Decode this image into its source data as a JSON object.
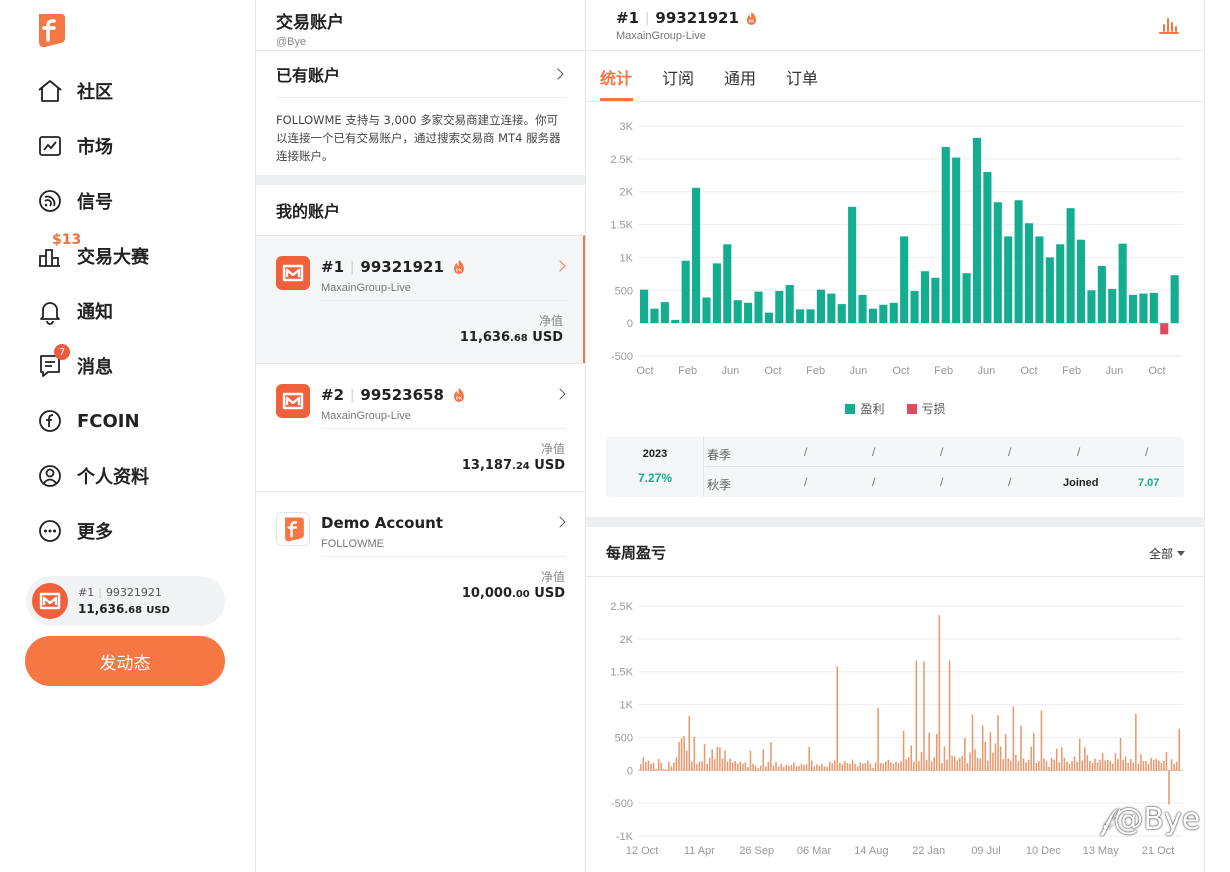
{
  "nav": {
    "items": [
      {
        "label": "社区",
        "icon": "home-icon"
      },
      {
        "label": "市场",
        "icon": "market-chart-icon"
      },
      {
        "label": "信号",
        "icon": "signal-icon"
      },
      {
        "label": "交易大赛",
        "icon": "contest-icon",
        "badge": "$13"
      },
      {
        "label": "通知",
        "icon": "bell-icon"
      },
      {
        "label": "消息",
        "icon": "message-icon",
        "badge": "7"
      },
      {
        "label": "FCOIN",
        "icon": "fcoin-icon"
      },
      {
        "label": "个人资料",
        "icon": "profile-icon"
      },
      {
        "label": "更多",
        "icon": "more-icon"
      }
    ],
    "account_pill": {
      "num": "#1",
      "id": "99321921",
      "equity_main": "11,636",
      "equity_dec": ".68",
      "currency": "USD"
    },
    "post_button": "发动态"
  },
  "middle": {
    "title": "交易账户",
    "subtitle": "@Bye",
    "existing_account": "已有账户",
    "description": "FOLLOWME 支持与 3,000 多家交易商建立连接。你可以连接一个已有交易账户，通过搜索交易商 MT4 服务器连接账户。",
    "my_accounts": "我的账户",
    "equity_label": "净值",
    "accounts": [
      {
        "num": "#1",
        "id": "99321921",
        "broker": "MaxainGroup-Live",
        "equity_main": "11,636",
        "equity_dec": ".68",
        "currency": "USD",
        "active": true
      },
      {
        "num": "#2",
        "id": "99523658",
        "broker": "MaxainGroup-Live",
        "equity_main": "13,187",
        "equity_dec": ".24",
        "currency": "USD",
        "active": false
      },
      {
        "name": "Demo Account",
        "broker": "FOLLOWME",
        "equity_main": "10,000",
        "equity_dec": ".00",
        "currency": "USD"
      }
    ]
  },
  "right": {
    "header": {
      "num": "#1",
      "id": "99321921",
      "broker": "MaxainGroup-Live"
    },
    "tabs": [
      "统计",
      "订阅",
      "通用",
      "订单"
    ],
    "legend": {
      "profit": "盈利",
      "loss": "亏损"
    },
    "season": {
      "year": "2023",
      "percent": "7.27%",
      "spring": "春季",
      "autumn": "秋季",
      "placeholder": "/",
      "joined_label": "Joined",
      "joined_value": "7.07"
    },
    "weekly_title": "每周盈亏",
    "weekly_filter": "全部"
  },
  "colors": {
    "accent": "#f47744",
    "profit": "#14ad8f",
    "loss": "#e04a5f",
    "weekly_bar": "#e8986e"
  },
  "chart_data": [
    {
      "type": "bar",
      "title": "",
      "x_tick_labels": [
        "Oct",
        "Feb",
        "Jun",
        "Oct",
        "Feb",
        "Jun",
        "Oct",
        "Feb",
        "Jun",
        "Oct",
        "Feb",
        "Jun",
        "Oct"
      ],
      "y_tick_labels": [
        "3K",
        "2.5K",
        "2K",
        "1.5K",
        "1K",
        "500",
        "0",
        "-500"
      ],
      "ylim": [
        -500,
        3000
      ],
      "series": [
        {
          "name": "盈利",
          "values": [
            510,
            220,
            320,
            50,
            950,
            2060,
            390,
            910,
            1200,
            350,
            310,
            480,
            160,
            490,
            580,
            210,
            210,
            510,
            450,
            290,
            1770,
            430,
            220,
            280,
            310,
            1320,
            490,
            790,
            690,
            2680,
            2520,
            760,
            2820,
            2300,
            1840,
            1320,
            1870,
            1520,
            1320,
            1000,
            1200,
            1750,
            1270,
            500,
            870,
            520,
            1210,
            430,
            450,
            460,
            0,
            730
          ]
        },
        {
          "name": "亏损",
          "values": [
            0,
            0,
            0,
            0,
            0,
            0,
            0,
            0,
            0,
            0,
            0,
            0,
            0,
            0,
            0,
            0,
            0,
            0,
            0,
            0,
            0,
            0,
            0,
            0,
            0,
            0,
            0,
            0,
            0,
            0,
            0,
            0,
            0,
            0,
            0,
            0,
            0,
            0,
            0,
            0,
            0,
            0,
            0,
            0,
            0,
            0,
            0,
            0,
            0,
            0,
            -170,
            0
          ]
        }
      ],
      "legend": "bottom"
    },
    {
      "type": "bar",
      "title": "",
      "x_tick_labels": [
        "12 Oct",
        "11 Apr",
        "26 Sep",
        "06 Mar",
        "14 Aug",
        "22 Jan",
        "09 Jul",
        "10 Dec",
        "13 May",
        "21 Oct"
      ],
      "y_tick_labels": [
        "2.5K",
        "2K",
        "1.5K",
        "1K",
        "500",
        "0",
        "-500",
        "-1K"
      ],
      "ylim": [
        -1000,
        2500
      ],
      "values": [
        90,
        200,
        130,
        150,
        100,
        110,
        20,
        170,
        120,
        20,
        10,
        130,
        60,
        120,
        200,
        430,
        490,
        520,
        300,
        830,
        130,
        510,
        100,
        130,
        140,
        400,
        100,
        190,
        320,
        170,
        360,
        350,
        180,
        300,
        130,
        180,
        120,
        140,
        100,
        130,
        100,
        120,
        50,
        300,
        100,
        70,
        30,
        70,
        320,
        60,
        130,
        430,
        70,
        130,
        60,
        100,
        50,
        80,
        70,
        80,
        120,
        60,
        70,
        100,
        80,
        90,
        360,
        150,
        60,
        90,
        70,
        100,
        60,
        50,
        130,
        110,
        150,
        1580,
        110,
        90,
        140,
        110,
        100,
        160,
        100,
        60,
        120,
        100,
        110,
        150,
        100,
        40,
        120,
        950,
        110,
        100,
        130,
        160,
        120,
        100,
        130,
        110,
        140,
        600,
        170,
        200,
        380,
        130,
        1670,
        140,
        280,
        1660,
        160,
        570,
        130,
        200,
        550,
        2360,
        110,
        360,
        160,
        1670,
        220,
        210,
        150,
        190,
        220,
        490,
        110,
        270,
        850,
        320,
        190,
        180,
        680,
        430,
        150,
        580,
        270,
        410,
        840,
        360,
        170,
        550,
        180,
        150,
        970,
        240,
        140,
        680,
        180,
        120,
        160,
        360,
        570,
        110,
        140,
        910,
        180,
        140,
        50,
        190,
        160,
        330,
        120,
        350,
        190,
        130,
        100,
        140,
        210,
        130,
        480,
        150,
        350,
        230,
        140,
        110,
        180,
        120,
        160,
        260,
        150,
        160,
        140,
        100,
        260,
        170,
        490,
        160,
        210,
        110,
        170,
        120,
        860,
        100,
        240,
        140,
        140,
        100,
        190,
        160,
        170,
        150,
        110,
        140,
        280,
        -520,
        170,
        100,
        130,
        630
      ]
    }
  ]
}
